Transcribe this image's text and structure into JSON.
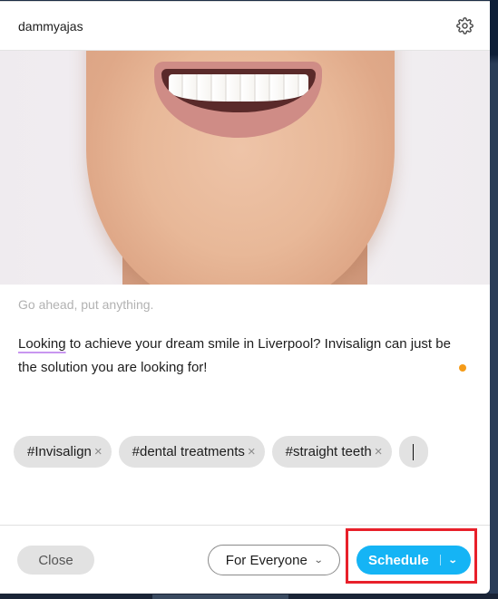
{
  "header": {
    "username": "dammyajas",
    "settings_icon": "gear-icon"
  },
  "media": {
    "description": "Close-up photo of a smiling woman's mouth and chin showing white teeth"
  },
  "composer": {
    "placeholder": "Go ahead, put anything.",
    "text_flagged_word": "Looking",
    "text_rest": " to achieve your dream smile in Liverpool? Invisalign can just be the solution you are looking for!",
    "status_dot_color": "#f59b18"
  },
  "tags": [
    {
      "label": "#Invisalign",
      "remove": "×"
    },
    {
      "label": "#dental treatments",
      "remove": "×"
    },
    {
      "label": "#straight teeth",
      "remove": "×"
    }
  ],
  "tag_input": {
    "value": ""
  },
  "footer": {
    "close_label": "Close",
    "audience_label": "For Everyone",
    "audience_chevron": "⌄",
    "schedule_label": "Schedule",
    "schedule_chevron": "⌄"
  },
  "colors": {
    "accent": "#15b4f5",
    "highlight": "#e8202a",
    "tag_bg": "#e2e2e2"
  }
}
